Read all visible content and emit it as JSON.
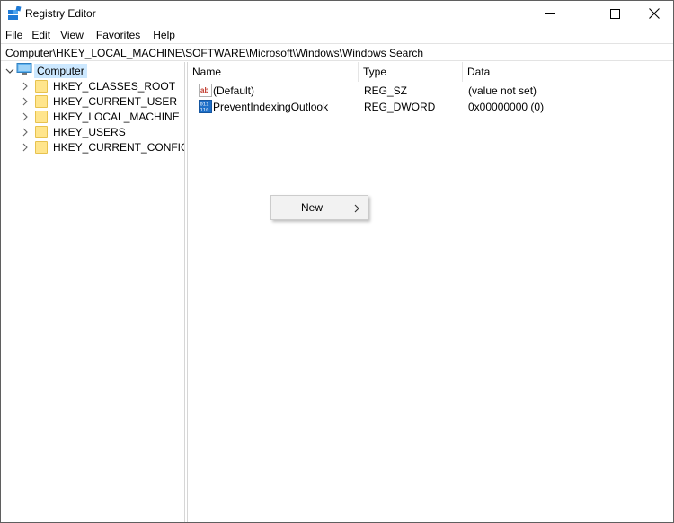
{
  "window": {
    "title": "Registry Editor",
    "controls": [
      "minimize",
      "maximize",
      "close"
    ]
  },
  "menu": [
    {
      "label": "File",
      "accel": "F",
      "rest": "ile"
    },
    {
      "label": "Edit",
      "accel": "E",
      "rest": "dit"
    },
    {
      "label": "View",
      "accel": "V",
      "rest": "iew"
    },
    {
      "label": "Favorites",
      "accel": "a",
      "pre": "F",
      "rest": "vorites"
    },
    {
      "label": "Help",
      "accel": "H",
      "rest": "elp"
    }
  ],
  "address": "Computer\\HKEY_LOCAL_MACHINE\\SOFTWARE\\Microsoft\\Windows\\Windows Search",
  "tree": {
    "root": "Computer",
    "hives": [
      "HKEY_CLASSES_ROOT",
      "HKEY_CURRENT_USER",
      "HKEY_LOCAL_MACHINE",
      "HKEY_USERS",
      "HKEY_CURRENT_CONFIG"
    ]
  },
  "columns": {
    "name": "Name",
    "type": "Type",
    "data": "Data"
  },
  "values": [
    {
      "name": "(Default)",
      "type": "REG_SZ",
      "data": "(value not set)",
      "icon": "string-value-icon"
    },
    {
      "name": "PreventIndexingOutlook",
      "type": "REG_DWORD",
      "data": "0x00000000 (0)",
      "icon": "dword-value-icon"
    }
  ],
  "context_menu": {
    "new_label": "New"
  }
}
